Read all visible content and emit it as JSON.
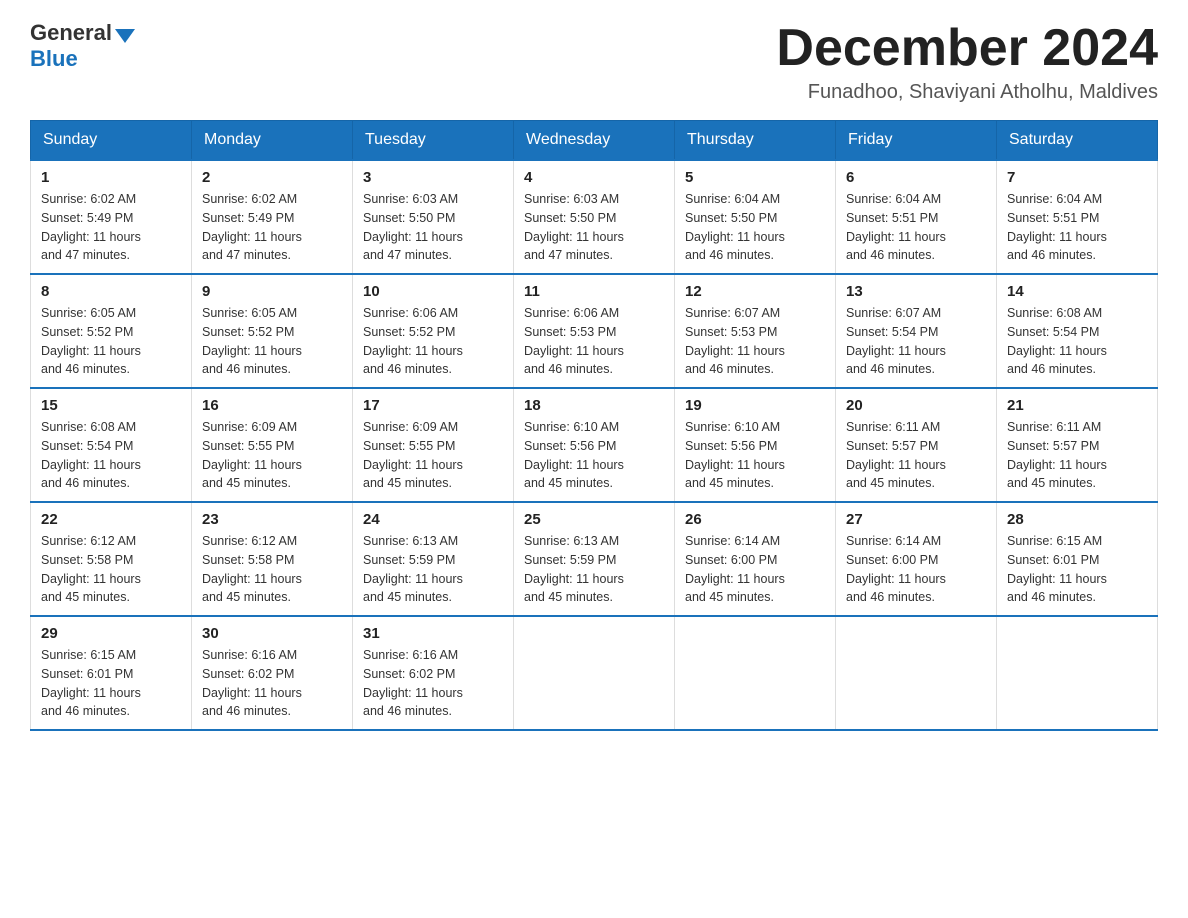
{
  "header": {
    "logo_general": "General",
    "logo_blue": "Blue",
    "month": "December 2024",
    "location": "Funadhoo, Shaviyani Atholhu, Maldives"
  },
  "days_of_week": [
    "Sunday",
    "Monday",
    "Tuesday",
    "Wednesday",
    "Thursday",
    "Friday",
    "Saturday"
  ],
  "weeks": [
    [
      {
        "day": "1",
        "sunrise": "6:02 AM",
        "sunset": "5:49 PM",
        "daylight": "11 hours and 47 minutes."
      },
      {
        "day": "2",
        "sunrise": "6:02 AM",
        "sunset": "5:49 PM",
        "daylight": "11 hours and 47 minutes."
      },
      {
        "day": "3",
        "sunrise": "6:03 AM",
        "sunset": "5:50 PM",
        "daylight": "11 hours and 47 minutes."
      },
      {
        "day": "4",
        "sunrise": "6:03 AM",
        "sunset": "5:50 PM",
        "daylight": "11 hours and 47 minutes."
      },
      {
        "day": "5",
        "sunrise": "6:04 AM",
        "sunset": "5:50 PM",
        "daylight": "11 hours and 46 minutes."
      },
      {
        "day": "6",
        "sunrise": "6:04 AM",
        "sunset": "5:51 PM",
        "daylight": "11 hours and 46 minutes."
      },
      {
        "day": "7",
        "sunrise": "6:04 AM",
        "sunset": "5:51 PM",
        "daylight": "11 hours and 46 minutes."
      }
    ],
    [
      {
        "day": "8",
        "sunrise": "6:05 AM",
        "sunset": "5:52 PM",
        "daylight": "11 hours and 46 minutes."
      },
      {
        "day": "9",
        "sunrise": "6:05 AM",
        "sunset": "5:52 PM",
        "daylight": "11 hours and 46 minutes."
      },
      {
        "day": "10",
        "sunrise": "6:06 AM",
        "sunset": "5:52 PM",
        "daylight": "11 hours and 46 minutes."
      },
      {
        "day": "11",
        "sunrise": "6:06 AM",
        "sunset": "5:53 PM",
        "daylight": "11 hours and 46 minutes."
      },
      {
        "day": "12",
        "sunrise": "6:07 AM",
        "sunset": "5:53 PM",
        "daylight": "11 hours and 46 minutes."
      },
      {
        "day": "13",
        "sunrise": "6:07 AM",
        "sunset": "5:54 PM",
        "daylight": "11 hours and 46 minutes."
      },
      {
        "day": "14",
        "sunrise": "6:08 AM",
        "sunset": "5:54 PM",
        "daylight": "11 hours and 46 minutes."
      }
    ],
    [
      {
        "day": "15",
        "sunrise": "6:08 AM",
        "sunset": "5:54 PM",
        "daylight": "11 hours and 46 minutes."
      },
      {
        "day": "16",
        "sunrise": "6:09 AM",
        "sunset": "5:55 PM",
        "daylight": "11 hours and 45 minutes."
      },
      {
        "day": "17",
        "sunrise": "6:09 AM",
        "sunset": "5:55 PM",
        "daylight": "11 hours and 45 minutes."
      },
      {
        "day": "18",
        "sunrise": "6:10 AM",
        "sunset": "5:56 PM",
        "daylight": "11 hours and 45 minutes."
      },
      {
        "day": "19",
        "sunrise": "6:10 AM",
        "sunset": "5:56 PM",
        "daylight": "11 hours and 45 minutes."
      },
      {
        "day": "20",
        "sunrise": "6:11 AM",
        "sunset": "5:57 PM",
        "daylight": "11 hours and 45 minutes."
      },
      {
        "day": "21",
        "sunrise": "6:11 AM",
        "sunset": "5:57 PM",
        "daylight": "11 hours and 45 minutes."
      }
    ],
    [
      {
        "day": "22",
        "sunrise": "6:12 AM",
        "sunset": "5:58 PM",
        "daylight": "11 hours and 45 minutes."
      },
      {
        "day": "23",
        "sunrise": "6:12 AM",
        "sunset": "5:58 PM",
        "daylight": "11 hours and 45 minutes."
      },
      {
        "day": "24",
        "sunrise": "6:13 AM",
        "sunset": "5:59 PM",
        "daylight": "11 hours and 45 minutes."
      },
      {
        "day": "25",
        "sunrise": "6:13 AM",
        "sunset": "5:59 PM",
        "daylight": "11 hours and 45 minutes."
      },
      {
        "day": "26",
        "sunrise": "6:14 AM",
        "sunset": "6:00 PM",
        "daylight": "11 hours and 45 minutes."
      },
      {
        "day": "27",
        "sunrise": "6:14 AM",
        "sunset": "6:00 PM",
        "daylight": "11 hours and 46 minutes."
      },
      {
        "day": "28",
        "sunrise": "6:15 AM",
        "sunset": "6:01 PM",
        "daylight": "11 hours and 46 minutes."
      }
    ],
    [
      {
        "day": "29",
        "sunrise": "6:15 AM",
        "sunset": "6:01 PM",
        "daylight": "11 hours and 46 minutes."
      },
      {
        "day": "30",
        "sunrise": "6:16 AM",
        "sunset": "6:02 PM",
        "daylight": "11 hours and 46 minutes."
      },
      {
        "day": "31",
        "sunrise": "6:16 AM",
        "sunset": "6:02 PM",
        "daylight": "11 hours and 46 minutes."
      },
      null,
      null,
      null,
      null
    ]
  ],
  "labels": {
    "sunrise": "Sunrise:",
    "sunset": "Sunset:",
    "daylight": "Daylight:"
  }
}
